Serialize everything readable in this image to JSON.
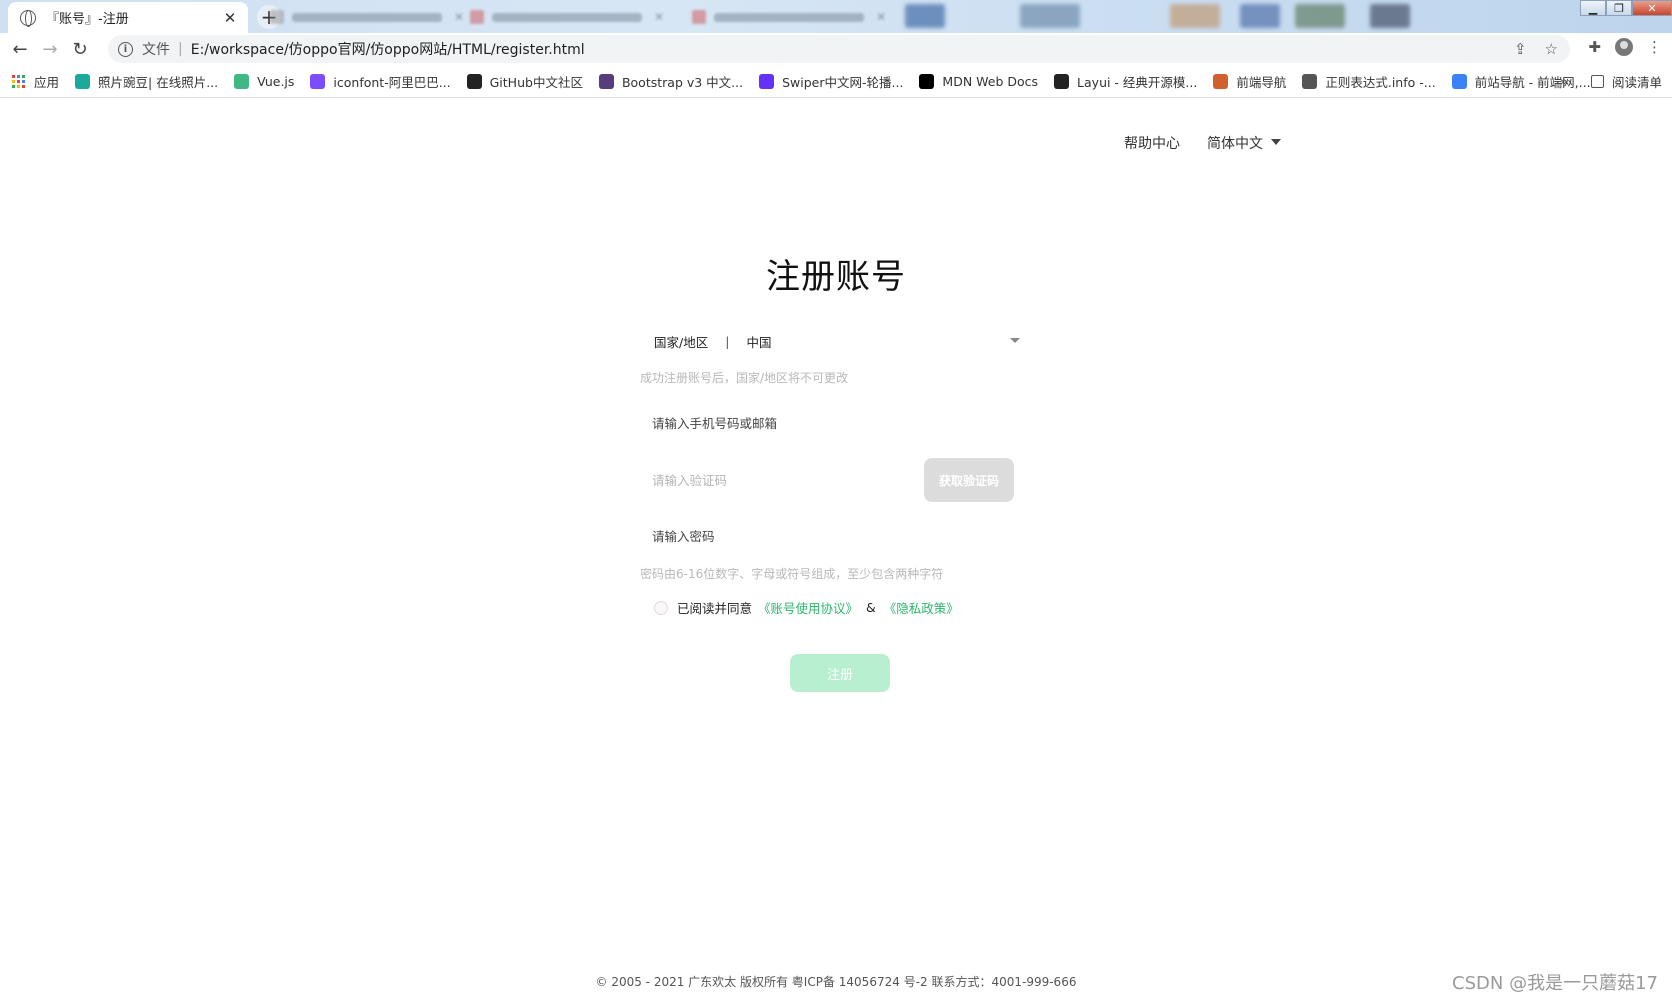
{
  "browser": {
    "active_tab_title": "『账号』-注册",
    "address": {
      "scheme_label": "文件",
      "url": "E:/workspace/仿oppo官网/仿oppo网站/HTML/register.html"
    },
    "bookmarks": [
      {
        "label": "应用",
        "icon": "apps-icon"
      },
      {
        "label": "照片豌豆| 在线照片...",
        "icon": "photo-icon",
        "color": "#1aa99a"
      },
      {
        "label": "Vue.js",
        "icon": "vue-icon",
        "color": "#41b883"
      },
      {
        "label": "iconfont-阿里巴巴...",
        "icon": "iconfont-icon",
        "color": "#7c4dff"
      },
      {
        "label": "GitHub中文社区",
        "icon": "github-icon",
        "color": "#222222"
      },
      {
        "label": "Bootstrap v3 中文...",
        "icon": "bootstrap-icon",
        "color": "#563d7c"
      },
      {
        "label": "Swiper中文网-轮播...",
        "icon": "swiper-icon",
        "color": "#6332f6"
      },
      {
        "label": "MDN Web Docs",
        "icon": "mdn-icon",
        "color": "#000000"
      },
      {
        "label": "Layui - 经典开源模...",
        "icon": "layui-icon",
        "color": "#222222"
      },
      {
        "label": "前端导航",
        "icon": "frontend-nav-icon",
        "color": "#d06030"
      },
      {
        "label": "正则表达式.info -...",
        "icon": "globe-icon",
        "color": "#555555"
      },
      {
        "label": "前站导航 - 前端网,...",
        "icon": "feather-icon",
        "color": "#3b82f6"
      }
    ],
    "reading_list_label": "阅读清单"
  },
  "page": {
    "help_link": "帮助中心",
    "language": "简体中文",
    "title": "注册账号",
    "country_label": "国家/地区",
    "country_value": "中国",
    "country_hint": "成功注册账号后，国家/地区将不可更改",
    "phone_placeholder": "请输入手机号码或邮箱",
    "code_placeholder": "请输入验证码",
    "get_code_button": "获取验证码",
    "password_placeholder": "请输入密码",
    "password_hint": "密码由6-16位数字、字母或符号组成，至少包含两种字符",
    "agree_text": "已阅读并同意",
    "agreement_link": "《账号使用协议》",
    "amp": "&",
    "privacy_link": "《隐私政策》",
    "submit_button": "注册",
    "footer": "© 2005 - 2021 广东欢太 版权所有 粤ICP备 14056724 号-2 联系方式：4001-999-666",
    "watermark": "CSDN @我是一只蘑菇17"
  },
  "colors": {
    "accent_green": "#2db56c",
    "submit_disabled": "#b7efd0",
    "code_button_disabled": "#dcdcdc"
  }
}
